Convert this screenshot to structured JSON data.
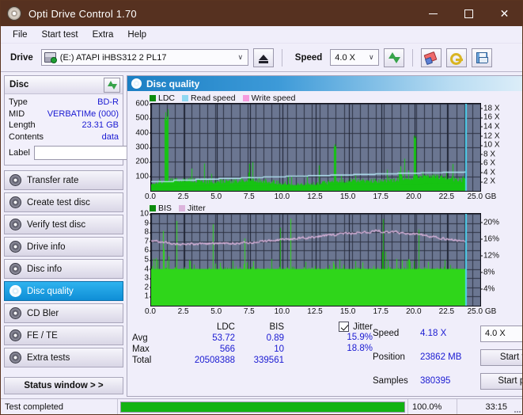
{
  "window": {
    "title": "Opti Drive Control 1.70",
    "icon": "disc-icon",
    "minimize": "—",
    "maximize": "□",
    "close": "✕"
  },
  "menu": {
    "items": [
      "File",
      "Start test",
      "Extra",
      "Help"
    ]
  },
  "toolbar": {
    "drive_label": "Drive",
    "drive_value": "(E:)  ATAPI iHBS312   2 PL17",
    "eject_icon": "eject-icon",
    "speed_label": "Speed",
    "speed_value": "4.0 X",
    "refresh_icon": "refresh-icon",
    "erase_icon": "eraser-icon",
    "key_icon": "key-icon",
    "save_icon": "save-icon",
    "chevron": "∨"
  },
  "disc_panel": {
    "title": "Disc",
    "refresh_icon": "refresh-icon",
    "rows": [
      {
        "key": "Type",
        "value": "BD-R"
      },
      {
        "key": "MID",
        "value": "VERBATIMe (000)"
      },
      {
        "key": "Length",
        "value": "23.31 GB"
      },
      {
        "key": "Contents",
        "value": "data"
      }
    ],
    "label_key": "Label",
    "label_value": "",
    "label_placeholder": "",
    "label_button_icon": "disc-icon"
  },
  "sidebar": {
    "items": [
      {
        "label": "Transfer rate",
        "icon": "disc-test-icon",
        "active": false
      },
      {
        "label": "Create test disc",
        "icon": "disc-create-icon",
        "active": false
      },
      {
        "label": "Verify test disc",
        "icon": "disc-verify-icon",
        "active": false
      },
      {
        "label": "Drive info",
        "icon": "disc-driveinfo-icon",
        "active": false
      },
      {
        "label": "Disc info",
        "icon": "disc-info-icon",
        "active": false
      },
      {
        "label": "Disc quality",
        "icon": "disc-quality-icon",
        "active": true
      },
      {
        "label": "CD Bler",
        "icon": "disc-bler-icon",
        "active": false
      },
      {
        "label": "FE / TE",
        "icon": "disc-fete-icon",
        "active": false
      },
      {
        "label": "Extra tests",
        "icon": "disc-extra-icon",
        "active": false
      }
    ],
    "status_window": "Status window > >"
  },
  "main": {
    "header_title": "Disc quality",
    "header_icon": "disc-quality-icon"
  },
  "stats": {
    "columns": [
      "LDC",
      "BIS"
    ],
    "rows": [
      {
        "key": "Avg",
        "ldc": "53.72",
        "bis": "0.89",
        "jitter": "15.9%"
      },
      {
        "key": "Max",
        "ldc": "566",
        "bis": "10",
        "jitter": "18.8%"
      },
      {
        "key": "Total",
        "ldc": "20508388",
        "bis": "339561",
        "jitter": ""
      }
    ],
    "jitter_label": "Jitter",
    "jitter_checked": true,
    "speed_key": "Speed",
    "speed_value": "4.18 X",
    "position_key": "Position",
    "position_value": "23862 MB",
    "samples_key": "Samples",
    "samples_value": "380395",
    "speed_select": "4.0 X",
    "start_full": "Start full",
    "start_part": "Start part"
  },
  "statusbar": {
    "message": "Test completed",
    "percent_text": "100.0%",
    "percent_value": 100,
    "time": "33:15"
  },
  "colors": {
    "titlebar": "#563120",
    "accent": "#0f8ed6",
    "value_blue": "#1a1ad2",
    "ldc_green": "#16c312",
    "bis_green": "#0d8c0d",
    "read_speed": "#8fd8f2",
    "write_speed": "#f59bdd",
    "jitter_pink": "#dcb4dc",
    "plot_bg": "#6b7691",
    "progress": "#13b313",
    "marker_cyan": "#4fd4f2"
  },
  "chart_data": [
    {
      "type": "bar",
      "name": "ldc-chart",
      "title": "",
      "xlabel": "GB",
      "ylabel": "LDC",
      "legend": [
        {
          "label": "LDC",
          "color": "#0d8c0d"
        },
        {
          "label": "Read speed",
          "color": "#8fd8f2"
        },
        {
          "label": "Write speed",
          "color": "#f59bdd"
        }
      ],
      "legend_position": "top-left",
      "grid": true,
      "x": [
        0.0,
        2.5,
        5.0,
        7.5,
        10.0,
        12.5,
        15.0,
        17.5,
        20.0,
        22.5,
        25.0
      ],
      "xtick_labels": [
        "0.0",
        "2.5",
        "5.0",
        "7.5",
        "10.0",
        "12.5",
        "15.0",
        "17.5",
        "20.0",
        "22.5",
        "25.0 GB"
      ],
      "xlim": [
        0,
        25.0
      ],
      "ylim": [
        0,
        600
      ],
      "ytick_labels": [
        "100",
        "200",
        "300",
        "400",
        "500",
        "600"
      ],
      "ytick_values": [
        100,
        200,
        300,
        400,
        500,
        600
      ],
      "y2lim": [
        0,
        19
      ],
      "y2tick_labels": [
        "2 X",
        "4 X",
        "6 X",
        "8 X",
        "10 X",
        "12 X",
        "14 X",
        "16 X",
        "18 X"
      ],
      "y2tick_values": [
        2,
        4,
        6,
        8,
        10,
        12,
        14,
        16,
        18
      ],
      "series": [
        {
          "name": "LDC",
          "type": "bar",
          "color": "#16c312",
          "baseline": 60,
          "peak_max": 566,
          "avg": 53.72,
          "note": "dense green spikes, base band ~40-100, occasional tall spikes up to 566"
        },
        {
          "name": "Read speed",
          "type": "line",
          "color": "#b7e9f8",
          "axis": "y2",
          "start": 2.0,
          "end": 4.18,
          "note": "stepped rising curve from about 2.0X at 0 GB to 4.18X at 23.8 GB"
        }
      ],
      "end_marker": {
        "x": 23.86,
        "color": "#4fd4f2"
      }
    },
    {
      "type": "bar",
      "name": "bis-chart",
      "title": "",
      "xlabel": "GB",
      "ylabel": "BIS",
      "legend": [
        {
          "label": "BIS",
          "color": "#0d8c0d"
        },
        {
          "label": "Jitter",
          "color": "#dcb4dc"
        }
      ],
      "legend_position": "top-left",
      "grid": true,
      "x": [
        0.0,
        2.5,
        5.0,
        7.5,
        10.0,
        12.5,
        15.0,
        17.5,
        20.0,
        22.5,
        25.0
      ],
      "xtick_labels": [
        "0.0",
        "2.5",
        "5.0",
        "7.5",
        "10.0",
        "12.5",
        "15.0",
        "17.5",
        "20.0",
        "22.5",
        "25.0 GB"
      ],
      "xlim": [
        0,
        25.0
      ],
      "ylim": [
        0,
        10
      ],
      "ytick_labels": [
        "1",
        "2",
        "3",
        "4",
        "5",
        "6",
        "7",
        "8",
        "9",
        "10"
      ],
      "ytick_values": [
        1,
        2,
        3,
        4,
        5,
        6,
        7,
        8,
        9,
        10
      ],
      "y2lim": [
        0,
        22
      ],
      "y2tick_labels": [
        "4%",
        "8%",
        "12%",
        "16%",
        "20%"
      ],
      "y2tick_values": [
        4,
        8,
        12,
        16,
        20
      ],
      "series": [
        {
          "name": "BIS",
          "type": "bar",
          "color": "#2fd61a",
          "baseline": 4.0,
          "peak_max": 10,
          "avg": 0.89,
          "note": "dense bars filling to about 4, with scattered spikes to 5-10"
        },
        {
          "name": "Jitter",
          "type": "line",
          "color": "#dcb4dc",
          "axis": "y2",
          "avg": 15.9,
          "max": 18.8,
          "note": "pink noisy line starting ~15.5%, dipping ~14.5%, rising to ~18% around 20 GB, falling to ~15% at end"
        }
      ],
      "end_marker": {
        "x": 23.86,
        "color": "#4fd4f2"
      }
    }
  ]
}
